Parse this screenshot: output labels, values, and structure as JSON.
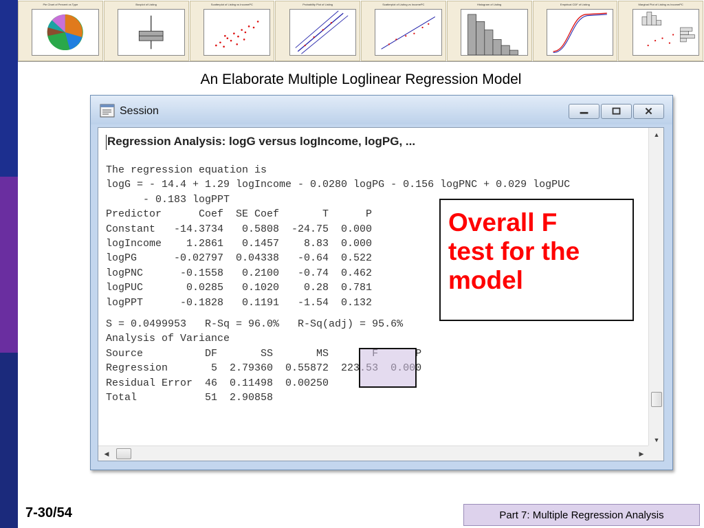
{
  "slide": {
    "title": "An Elaborate Multiple Loglinear Regression Model",
    "page_number": "7-30/54",
    "footer": "Part 7: Multiple Regression Analysis"
  },
  "thumbnails": [
    {
      "title": "Pie Chart of Percent vs Type",
      "kind": "pie"
    },
    {
      "title": "Boxplot of Listing",
      "kind": "boxplot"
    },
    {
      "title": "Scatterplot of Listing vs IncomePC",
      "kind": "scatter"
    },
    {
      "title": "Probability Plot of Listing",
      "kind": "probability"
    },
    {
      "title": "Scatterplot of Listing vs IncomePC",
      "kind": "equation"
    },
    {
      "title": "Histogram of Listing",
      "kind": "histogram"
    },
    {
      "title": "Empirical CDF of Listing",
      "kind": "cdf"
    },
    {
      "title": "Marginal Plot of Listing vs IncomePC",
      "kind": "marginal"
    }
  ],
  "window": {
    "title": "Session",
    "heading": "Regression Analysis: logG versus logIncome, logPG, ...",
    "equation_intro": "The regression equation is",
    "equation_line1": "logG = - 14.4 + 1.29 logIncome - 0.0280 logPG - 0.156 logPNC + 0.029 logPUC",
    "equation_line2": "      - 0.183 logPPT",
    "coef_header": "Predictor      Coef  SE Coef       T      P",
    "coef_rows": [
      "Constant   -14.3734   0.5808  -24.75  0.000",
      "logIncome    1.2861   0.1457    8.83  0.000",
      "logPG      -0.02797  0.04338   -0.64  0.522",
      "logPNC      -0.1558   0.2100   -0.74  0.462",
      "logPUC       0.0285   0.1020    0.28  0.781",
      "logPPT      -0.1828   0.1191   -1.54  0.132"
    ],
    "fit_stats": "S = 0.0499953   R-Sq = 96.0%   R-Sq(adj) = 95.6%",
    "anova_title": "Analysis of Variance",
    "anova_header": "Source          DF       SS       MS       F      P",
    "anova_rows": [
      "Regression       5  2.79360  0.55872  223.53  0.000",
      "Residual Error  46  0.11498  0.00250",
      "Total           51  2.90858"
    ]
  },
  "callout": {
    "line1": "Overall F",
    "line2": "test for the",
    "line3": "model"
  },
  "colors": {
    "band_top": "#1c2f8f",
    "band_middle": "#6a2ea0",
    "band_bottom": "#1b2a7c",
    "callout_text": "#ff0000",
    "highlight": "#cdbee1",
    "footer_bg": "#ddd2ec"
  }
}
